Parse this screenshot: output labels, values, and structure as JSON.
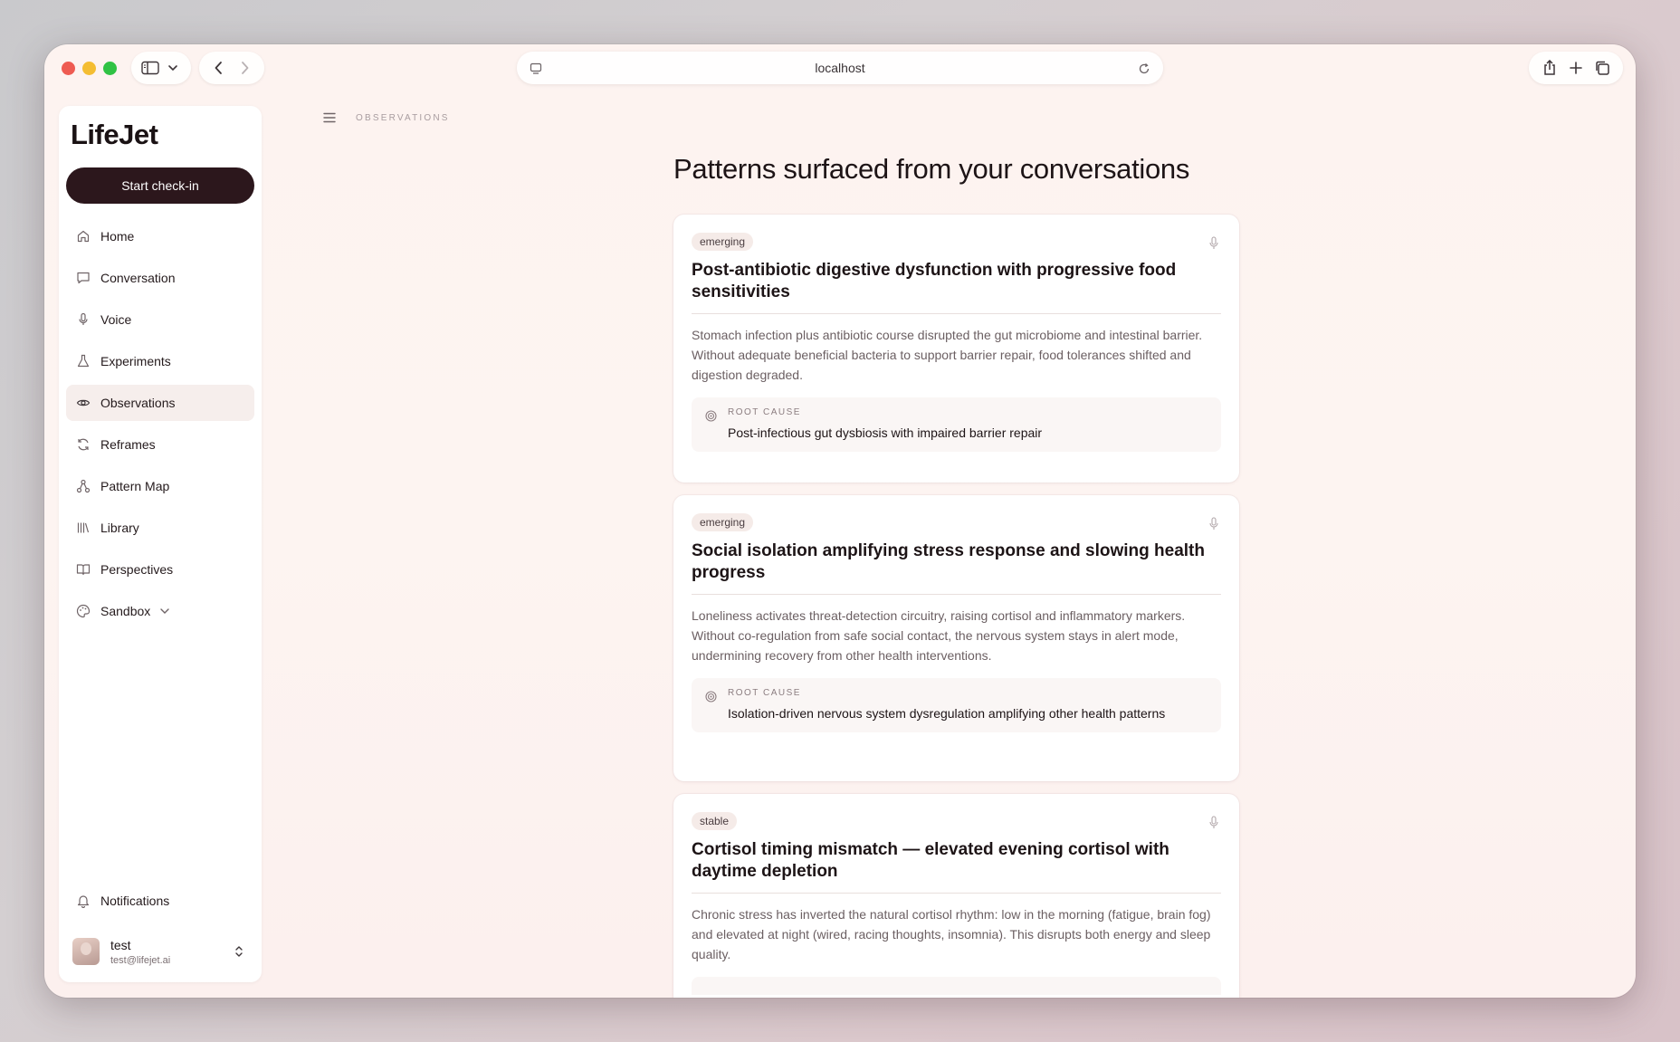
{
  "browser": {
    "url": "localhost"
  },
  "sidebar": {
    "logo": "LifeJet",
    "checkin_label": "Start check-in",
    "items": [
      {
        "label": "Home",
        "icon": "home-icon"
      },
      {
        "label": "Conversation",
        "icon": "chat-icon"
      },
      {
        "label": "Voice",
        "icon": "mic-icon"
      },
      {
        "label": "Experiments",
        "icon": "flask-icon"
      },
      {
        "label": "Observations",
        "icon": "eye-icon",
        "active": true
      },
      {
        "label": "Reframes",
        "icon": "refresh-icon"
      },
      {
        "label": "Pattern Map",
        "icon": "network-icon"
      },
      {
        "label": "Library",
        "icon": "library-icon"
      },
      {
        "label": "Perspectives",
        "icon": "book-icon"
      },
      {
        "label": "Sandbox",
        "icon": "palette-icon"
      }
    ],
    "notifications_label": "Notifications",
    "user": {
      "name": "test",
      "email": "test@lifejet.ai"
    }
  },
  "main": {
    "breadcrumb": "OBSERVATIONS",
    "title": "Patterns surfaced from your conversations",
    "cards": [
      {
        "status": "emerging",
        "title": "Post-antibiotic digestive dysfunction with progressive food sensitivities",
        "body": "Stomach infection plus antibiotic course disrupted the gut microbiome and intestinal barrier. Without adequate beneficial bacteria to support barrier repair, food tolerances shifted and digestion degraded.",
        "root_label": "ROOT CAUSE",
        "root_text": "Post-infectious gut dysbiosis with impaired barrier repair"
      },
      {
        "status": "emerging",
        "title": "Social isolation amplifying stress response and slowing health progress",
        "body": "Loneliness activates threat-detection circuitry, raising cortisol and inflammatory markers. Without co-regulation from safe social contact, the nervous system stays in alert mode, undermining recovery from other health interventions.",
        "root_label": "ROOT CAUSE",
        "root_text": "Isolation-driven nervous system dysregulation amplifying other health patterns"
      },
      {
        "status": "stable",
        "title": "Cortisol timing mismatch — elevated evening cortisol with daytime depletion",
        "body": "Chronic stress has inverted the natural cortisol rhythm: low in the morning (fatigue, brain fog) and elevated at night (wired, racing thoughts, insomnia). This disrupts both energy and sleep quality."
      }
    ]
  }
}
